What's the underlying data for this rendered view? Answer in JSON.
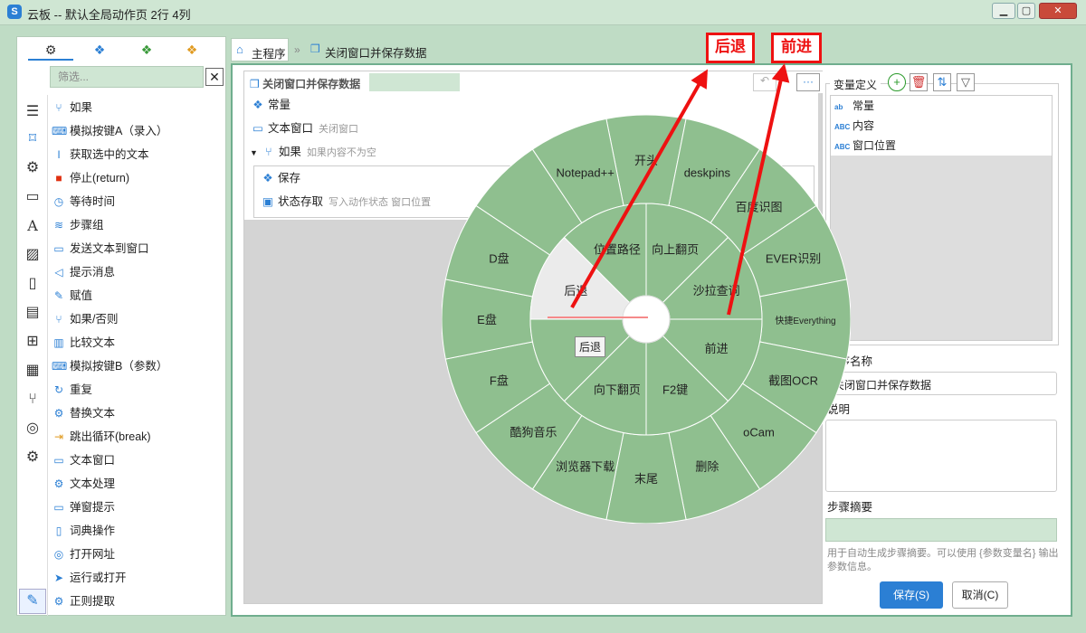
{
  "window": {
    "title": "云板 -- 默认全局动作页 2行 4列",
    "logo": "S",
    "minimize": "▁",
    "maximize": "▢",
    "close": "✕"
  },
  "left_panel": {
    "tabs": [
      "gear-cluster-icon",
      "blue-cubes-icon",
      "green-cubes-icon",
      "orange-cubes-icon"
    ],
    "filter_placeholder": "筛选...",
    "filter_clear": "✕",
    "side_icons": [
      "menu-icon",
      "bookmark-icon",
      "settings-icon",
      "window-icon",
      "font-icon",
      "image-icon",
      "clipboard-icon",
      "document-icon",
      "windows-icon",
      "grid-icon",
      "branch-icon",
      "globe-icon",
      "gears-icon"
    ],
    "items": [
      "如果",
      "模拟按键A（录入）",
      "获取选中的文本",
      "停止(return)",
      "等待时间",
      "步骤组",
      "发送文本到窗口",
      "提示消息",
      "赋值",
      "如果/否则",
      "比较文本",
      "模拟按键B（参数）",
      "重复",
      "替换文本",
      "跳出循环(break)",
      "文本窗口",
      "文本处理",
      "弹窗提示",
      "词典操作",
      "打开网址",
      "运行或打开",
      "正则提取"
    ]
  },
  "breadcrumb": {
    "home": "主程序",
    "sep": "»",
    "current": "关闭窗口并保存数据"
  },
  "editor": {
    "title": "关闭窗口并保存数据",
    "more": "···",
    "undo": "↶",
    "steps": [
      {
        "label": "常量",
        "sub": ""
      },
      {
        "label": "文本窗口",
        "sub": "关闭窗口"
      },
      {
        "label": "如果",
        "sub": "如果内容不为空"
      },
      {
        "label": "保存",
        "sub": ""
      },
      {
        "label": "状态存取",
        "sub": "写入动作状态  窗口位置"
      }
    ]
  },
  "radial_menu": {
    "outer": [
      "开头",
      "deskpins",
      "百度识图",
      "EVER识别",
      "快捷Everything",
      "截图OCR",
      "oCam",
      "删除",
      "末尾",
      "浏览器下载",
      "酷狗音乐",
      "F盘",
      "E盘",
      "D盘",
      "",
      "Notepad++"
    ],
    "inner": [
      "向上翻页",
      "沙拉查词",
      "前进",
      "F2键",
      "向下翻页",
      "",
      "后退",
      "位置路径"
    ],
    "tooltip": "后退",
    "colors": {
      "sector": "#8fbf8f",
      "highlight": "#ebebeb",
      "line": "#ffffff"
    }
  },
  "annotations": {
    "back": "后退",
    "forward": "前进",
    "color": "#e11111"
  },
  "right_panel": {
    "var_title": "变量定义",
    "var_buttons": [
      "+",
      "🗑",
      "⇅",
      "▽"
    ],
    "variables": [
      {
        "tag": "ab",
        "name": "常量"
      },
      {
        "tag": "ABC",
        "name": "内容"
      },
      {
        "tag": "ABC",
        "name": "窗口位置"
      }
    ],
    "program_name_label": "程序名称",
    "program_name": "关闭窗口并保存数据",
    "desc_label": "说明",
    "summary_label": "步骤摘要",
    "hint": "用于自动生成步骤摘要。可以使用 {参数变量名} 输出参数信息。",
    "save": "保存(S)",
    "cancel": "取消(C)"
  }
}
